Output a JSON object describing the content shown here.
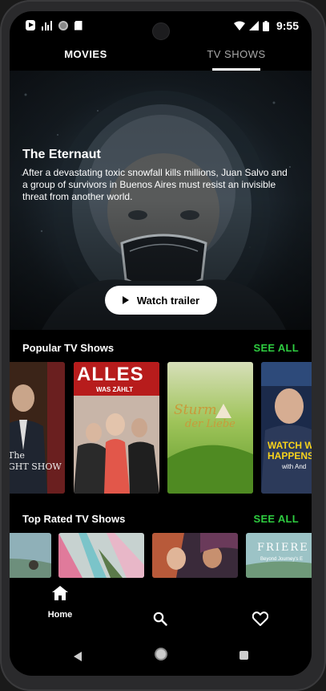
{
  "status_bar": {
    "time": "9:55"
  },
  "tabs": [
    {
      "label": "MOVIES"
    },
    {
      "label": "TV SHOWS"
    }
  ],
  "hero": {
    "title": "The Eternaut",
    "description": "After a devastating toxic snowfall kills millions, Juan Salvo and a group of survivors in Buenos Aires must resist an invisible threat from another world.",
    "button_label": "Watch trailer"
  },
  "sections": {
    "popular": {
      "title": "Popular TV Shows",
      "see_all": "SEE ALL",
      "posters": [
        {
          "lines": [
            "The",
            "GHT SHOW"
          ]
        },
        {
          "lines": [
            "ALLES",
            "WAS ZÄHLT"
          ]
        },
        {
          "lines": [
            "Sturm",
            "der Liebe"
          ]
        },
        {
          "lines": [
            "WATCH W",
            "HAPPENS",
            "with And"
          ]
        }
      ]
    },
    "top_rated": {
      "title": "Top Rated TV Shows",
      "see_all": "SEE ALL",
      "posters": [
        {
          "lines": []
        },
        {
          "lines": []
        },
        {
          "lines": []
        },
        {
          "lines": [
            "FRIERE",
            "Beyond Journey's E"
          ]
        }
      ]
    }
  },
  "bottom_nav": {
    "home_label": "Home"
  },
  "colors": {
    "accent": "#2ecc40",
    "background": "#000000"
  }
}
